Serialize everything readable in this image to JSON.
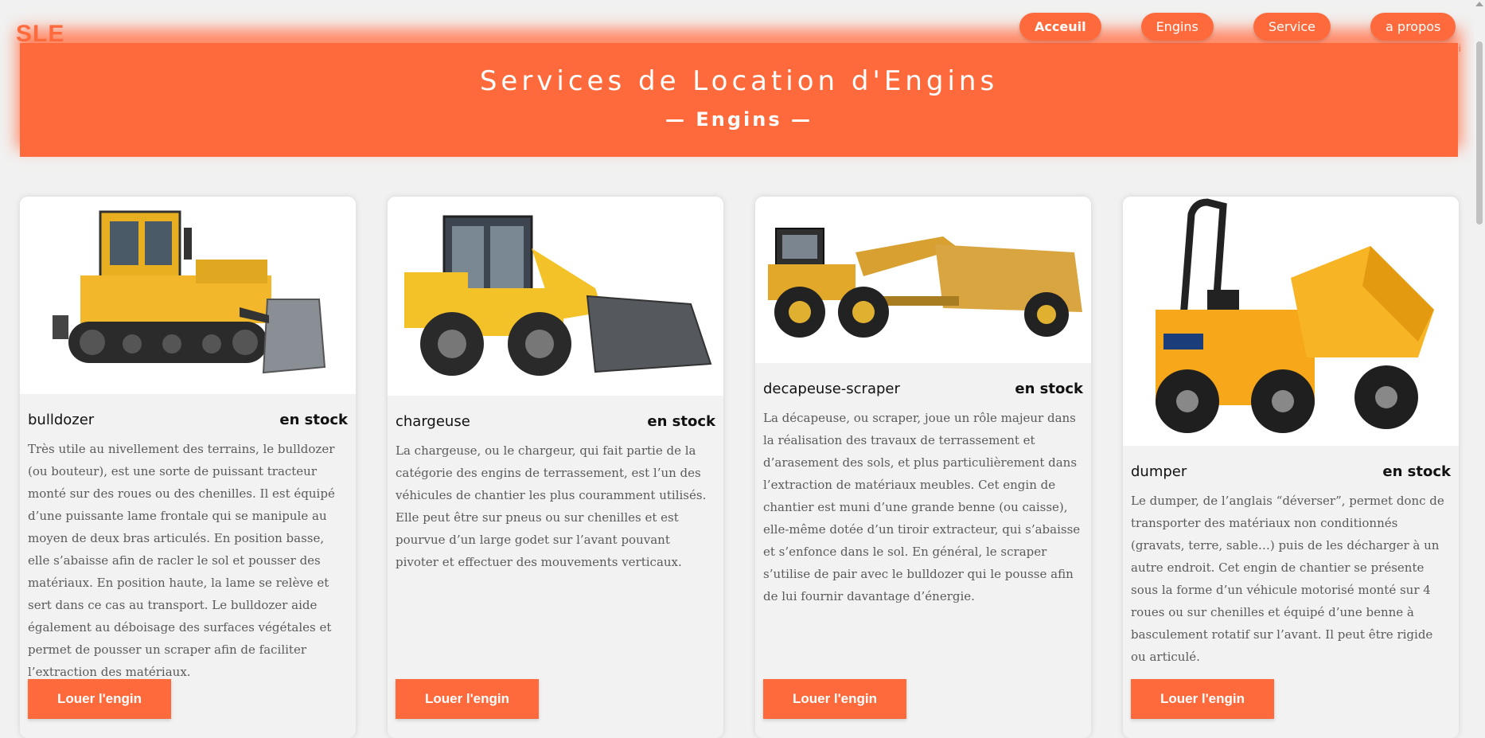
{
  "brand": {
    "logo": "SLE"
  },
  "nav": {
    "items": [
      "Acceuil",
      "Engins",
      "Service",
      "a propos"
    ],
    "active": 0
  },
  "hero": {
    "title": "Services de Location d'Engins",
    "subtitle": "— Engins —"
  },
  "stray_text": "ci",
  "colors": {
    "accent": "#ff6a3d",
    "card": "#f2f2f2",
    "page": "#f1f1f1"
  },
  "cards": [
    {
      "name": "bulldozer",
      "stock": "en stock",
      "image": "bulldozer-image",
      "description": "Très utile au nivellement des terrains, le bulldozer (ou bouteur), est une sorte de puissant tracteur monté sur des roues ou des chenilles. Il est équipé d’une puissante lame frontale qui se manipule au moyen de deux bras articulés. En position basse, elle s’abaisse afin de racler le sol et pousser des matériaux. En position haute, la lame se relève et sert dans ce cas au transport. Le bulldozer aide également au déboisage des surfaces végétales et permet de pousser un scraper afin de faciliter l’extraction des matériaux.",
      "button": "Louer l'engin"
    },
    {
      "name": "chargeuse",
      "stock": "en stock",
      "image": "loader-image",
      "description": "La chargeuse, ou le chargeur, qui fait partie de la catégorie des engins de terrassement, est l’un des véhicules de chantier les plus couramment utilisés. Elle peut être sur pneus ou sur chenilles et est pourvue d’un large godet sur l’avant pouvant pivoter et effectuer des mouvements verticaux.",
      "button": "Louer l'engin"
    },
    {
      "name": "decapeuse-scraper",
      "stock": "en stock",
      "image": "scraper-image",
      "description": "La décapeuse, ou scraper, joue un rôle majeur dans la réalisation des travaux de terrassement et d’arasement des sols, et plus particulièrement dans l’extraction de matériaux meubles. Cet engin de chantier est muni d’une grande benne (ou caisse), elle-même dotée d’un tiroir extracteur, qui s’abaisse et s’enfonce dans le sol. En général, le scraper s’utilise de pair avec le bulldozer qui le pousse afin de lui fournir davantage d’énergie.",
      "button": "Louer l'engin"
    },
    {
      "name": "dumper",
      "stock": "en stock",
      "image": "dumper-image",
      "description": "Le dumper, de l’anglais “déverser”, permet donc de transporter des matériaux non conditionnés (gravats, terre, sable…) puis de les décharger à un autre endroit. Cet engin de chantier se présente sous la forme d’un véhicule motorisé monté sur 4 roues ou sur chenilles et équipé d’une benne à basculement rotatif sur l’avant. Il peut être rigide ou articulé.",
      "button": "Louer l'engin"
    }
  ]
}
